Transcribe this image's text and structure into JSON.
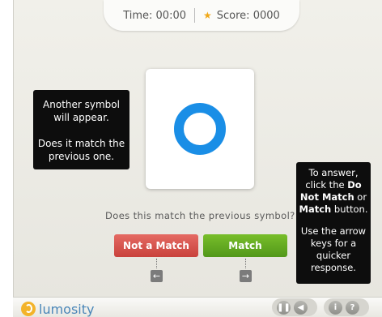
{
  "hud": {
    "time_label": "Time:",
    "time_value": "00:00",
    "score_label": "Score:",
    "score_value": "0000"
  },
  "card": {
    "symbol": "circle",
    "symbol_color": "#1a8ee6"
  },
  "tip_left": {
    "line1": "Another symbol",
    "line2": "will appear.",
    "line3": "Does it match the",
    "line4": "previous one."
  },
  "tip_right": {
    "l1": "To answer,",
    "l2a": "click the ",
    "l2b": "Do",
    "l3a": "Not Match",
    "l3b": " or",
    "l4a": "Match",
    "l4b": " button.",
    "l5": "Use the arrow",
    "l6": "keys for a",
    "l7": "quicker",
    "l8": "response."
  },
  "question": "Does this match the previous symbol?",
  "buttons": {
    "no_match": "Not a Match",
    "match": "Match"
  },
  "keys": {
    "left": "left-arrow-icon",
    "right": "right-arrow-icon"
  },
  "footer": {
    "logo_text": "lumosity",
    "controls": [
      "pause-icon",
      "sound-icon",
      "info-icon",
      "help-icon"
    ]
  },
  "colors": {
    "nomatch": "#d9534f",
    "match": "#66ad22",
    "accent": "#1a8ee6",
    "star": "#f0a818"
  }
}
